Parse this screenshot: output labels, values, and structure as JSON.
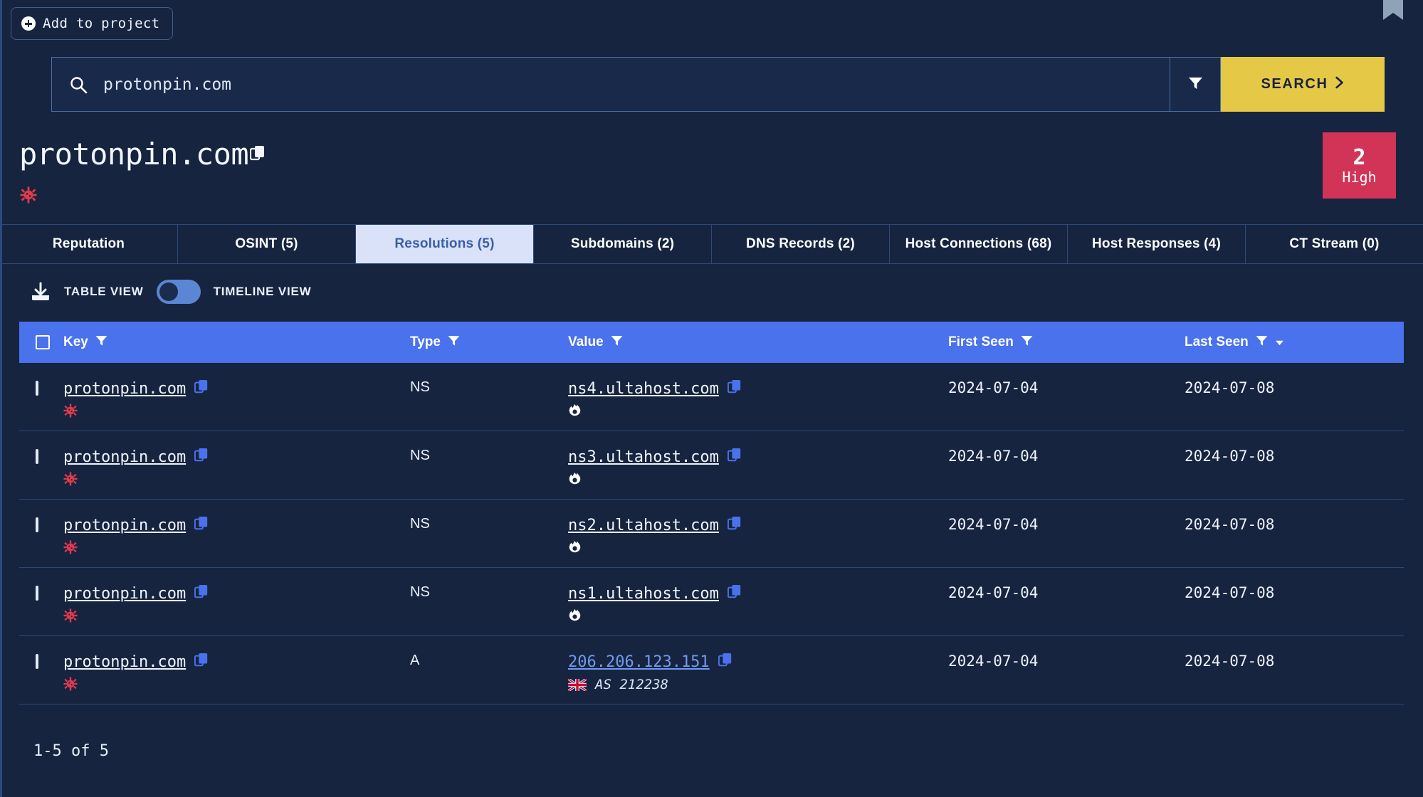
{
  "window": {
    "bookmark_icon": "bookmark-icon",
    "bg_color": "#16243f"
  },
  "toolbar": {
    "add_to_project_label": "Add to project",
    "add_icon": "plus-circle-icon"
  },
  "search": {
    "value": "protonpin.com",
    "placeholder": "protonpin.com",
    "search_icon": "magnifier-icon",
    "filter_icon": "filter-funnel-icon",
    "button_label": "SEARCH",
    "button_chevron": "chevron-right-icon",
    "button_color": "#e6c847"
  },
  "header": {
    "title": "protonpin.com",
    "copy_icon": "copy-icon",
    "malware_icon": "virus-icon",
    "risk": {
      "score": "2",
      "level": "High",
      "color": "#d13457"
    }
  },
  "tabs": [
    {
      "label": "Reputation",
      "active": false
    },
    {
      "label": "OSINT (5)",
      "active": false
    },
    {
      "label": "Resolutions (5)",
      "active": true
    },
    {
      "label": "Subdomains (2)",
      "active": false
    },
    {
      "label": "DNS Records (2)",
      "active": false
    },
    {
      "label": "Host Connections (68)",
      "active": false
    },
    {
      "label": "Host Responses (4)",
      "active": false
    },
    {
      "label": "CT Stream (0)",
      "active": false
    }
  ],
  "viewbar": {
    "download_icon": "download-icon",
    "table_view_label": "TABLE VIEW",
    "timeline_view_label": "TIMELINE VIEW",
    "toggle_state": "table",
    "toggle_color": "#5b86d4"
  },
  "table": {
    "header_color": "#4a72ec",
    "columns": [
      {
        "label": "Key",
        "filter_icon": "filter-funnel-icon",
        "sort_icon": null
      },
      {
        "label": "Type",
        "filter_icon": "filter-funnel-icon",
        "sort_icon": null
      },
      {
        "label": "Value",
        "filter_icon": "filter-funnel-icon",
        "sort_icon": null
      },
      {
        "label": "First Seen",
        "filter_icon": "filter-funnel-icon",
        "sort_icon": null
      },
      {
        "label": "Last Seen",
        "filter_icon": "filter-funnel-icon",
        "sort_icon": "sort-desc-icon"
      }
    ],
    "rows": [
      {
        "key": "protonpin.com",
        "key_badge": "virus-icon",
        "type": "NS",
        "value": "ns4.ultahost.com",
        "value_badge": "flame-icon",
        "value_is_ip": false,
        "first_seen": "2024-07-04",
        "last_seen": "2024-07-08"
      },
      {
        "key": "protonpin.com",
        "key_badge": "virus-icon",
        "type": "NS",
        "value": "ns3.ultahost.com",
        "value_badge": "flame-icon",
        "value_is_ip": false,
        "first_seen": "2024-07-04",
        "last_seen": "2024-07-08"
      },
      {
        "key": "protonpin.com",
        "key_badge": "virus-icon",
        "type": "NS",
        "value": "ns2.ultahost.com",
        "value_badge": "flame-icon",
        "value_is_ip": false,
        "first_seen": "2024-07-04",
        "last_seen": "2024-07-08"
      },
      {
        "key": "protonpin.com",
        "key_badge": "virus-icon",
        "type": "NS",
        "value": "ns1.ultahost.com",
        "value_badge": "flame-icon",
        "value_is_ip": false,
        "first_seen": "2024-07-04",
        "last_seen": "2024-07-08"
      },
      {
        "key": "protonpin.com",
        "key_badge": "virus-icon",
        "type": "A",
        "value": "206.206.123.151",
        "value_badge": "uk-flag-icon",
        "value_asn": "AS 212238",
        "value_is_ip": true,
        "first_seen": "2024-07-04",
        "last_seen": "2024-07-08"
      }
    ]
  },
  "pagination": {
    "range_label": "1-5 of 5"
  }
}
